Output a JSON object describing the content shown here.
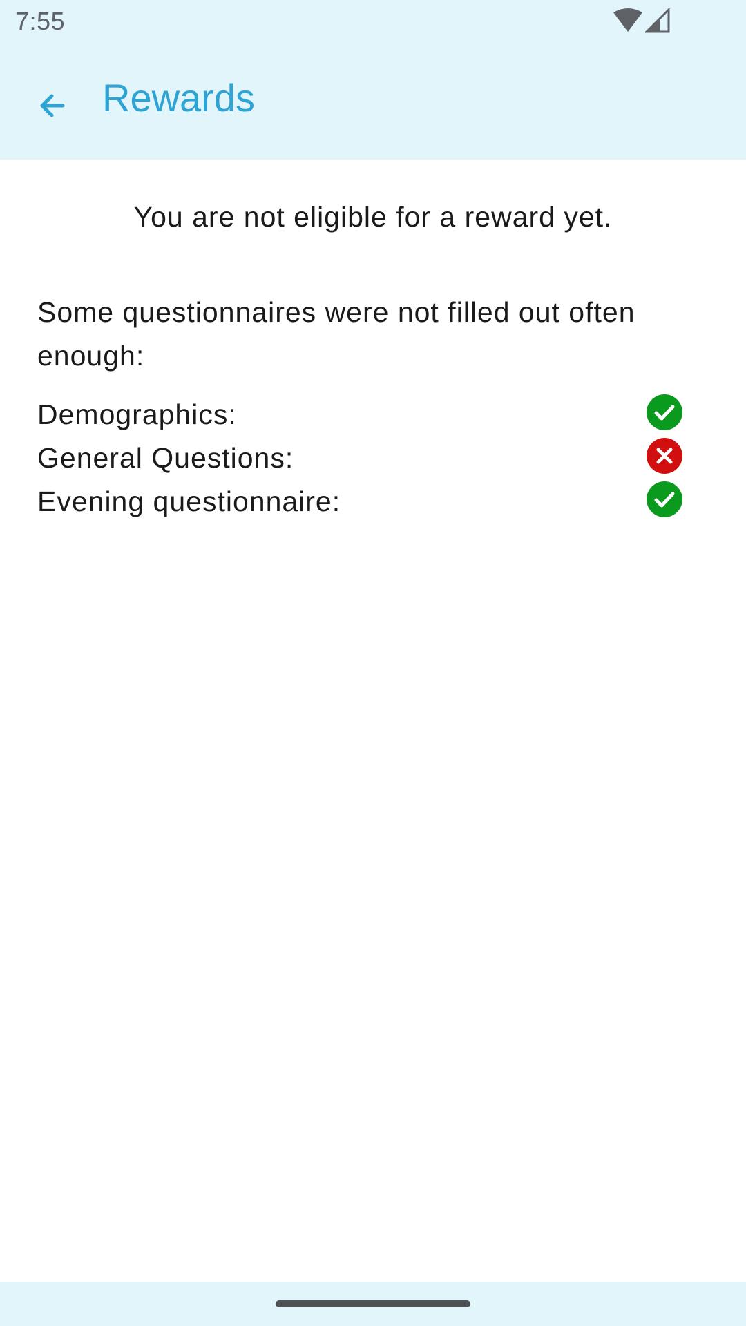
{
  "status_bar": {
    "time": "7:55",
    "icons": [
      "wifi-icon",
      "signal-icon"
    ]
  },
  "app_bar": {
    "back_icon": "arrow-back-icon",
    "title": "Rewards",
    "title_color": "#2ea3d4",
    "background": "#e1f5fb"
  },
  "main": {
    "eligibility_message": "You are not eligible for a reward yet.",
    "explanation": "Some questionnaires were not filled out often enough:",
    "questionnaires": [
      {
        "label": "Demographics:",
        "status": "complete",
        "icon": "check-circle-icon"
      },
      {
        "label": "General Questions:",
        "status": "incomplete",
        "icon": "cross-circle-icon"
      },
      {
        "label": "Evening questionnaire:",
        "status": "complete",
        "icon": "check-circle-icon"
      }
    ]
  },
  "colors": {
    "success": "#0a9a1e",
    "error": "#d20f0f",
    "text": "#1a1a1a"
  }
}
